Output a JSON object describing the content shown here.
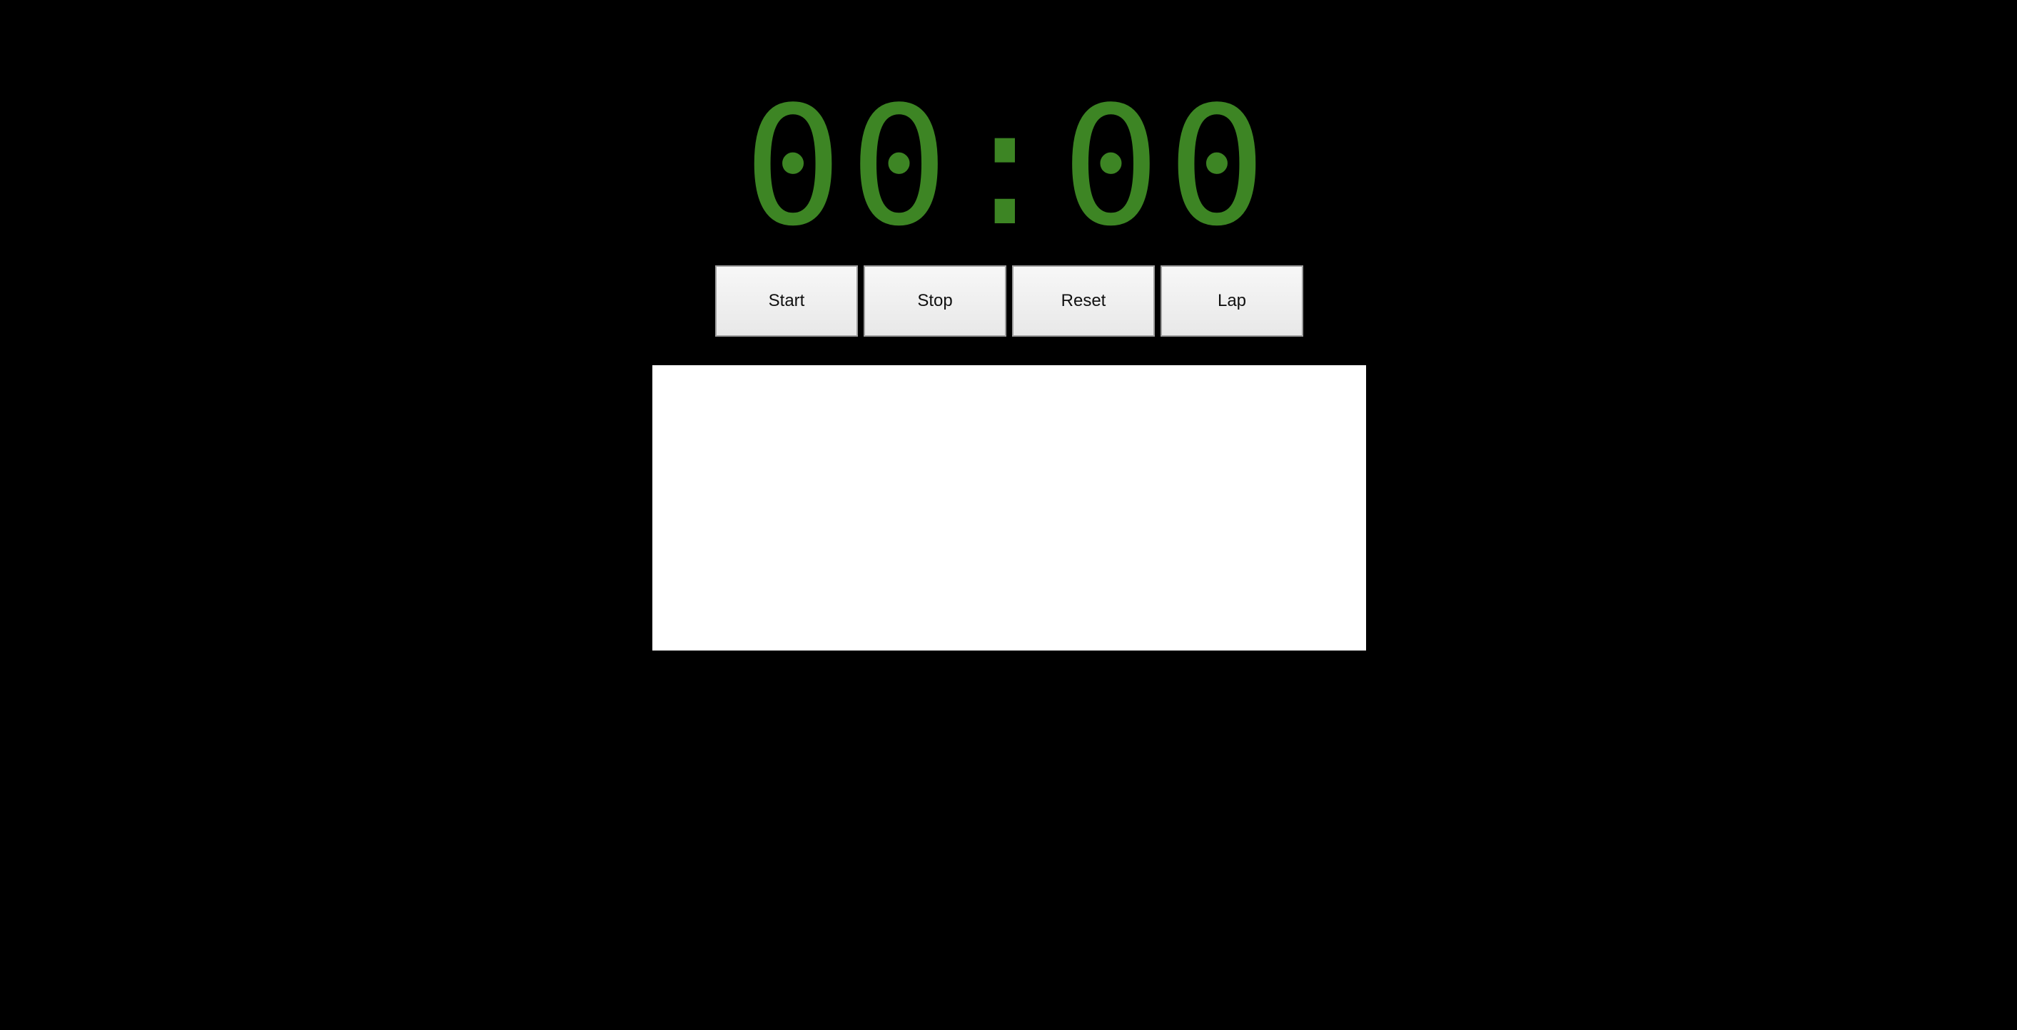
{
  "display": {
    "time": "00:00",
    "color": "#3d8524"
  },
  "controls": {
    "start_label": "Start",
    "stop_label": "Stop",
    "reset_label": "Reset",
    "lap_label": "Lap"
  },
  "laps": []
}
